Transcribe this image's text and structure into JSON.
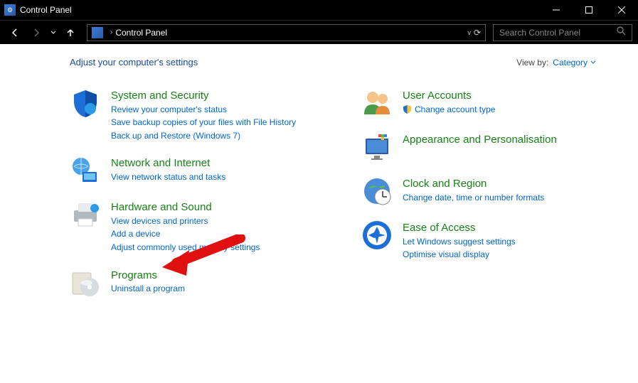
{
  "window": {
    "title": "Control Panel",
    "min": "minimize",
    "max": "maximize",
    "close": "close"
  },
  "toolbar": {
    "back": "back",
    "fwd": "forward",
    "recent": "recent",
    "up": "up",
    "breadcrumb": "Control Panel",
    "refresh": "refresh",
    "search_placeholder": "Search Control Panel"
  },
  "heading": "Adjust your computer's settings",
  "viewby": {
    "label": "View by:",
    "value": "Category"
  },
  "left": [
    {
      "title": "System and Security",
      "links": [
        "Review your computer's status",
        "Save backup copies of your files with File History",
        "Back up and Restore (Windows 7)"
      ]
    },
    {
      "title": "Network and Internet",
      "links": [
        "View network status and tasks"
      ]
    },
    {
      "title": "Hardware and Sound",
      "links": [
        "View devices and printers",
        "Add a device",
        "Adjust commonly used mobility settings"
      ]
    },
    {
      "title": "Programs",
      "links": [
        "Uninstall a program"
      ]
    }
  ],
  "right": [
    {
      "title": "User Accounts",
      "links": [
        "Change account type"
      ],
      "shielded": [
        true
      ]
    },
    {
      "title": "Appearance and Personalisation",
      "links": []
    },
    {
      "title": "Clock and Region",
      "links": [
        "Change date, time or number formats"
      ]
    },
    {
      "title": "Ease of Access",
      "links": [
        "Let Windows suggest settings",
        "Optimise visual display"
      ]
    }
  ]
}
